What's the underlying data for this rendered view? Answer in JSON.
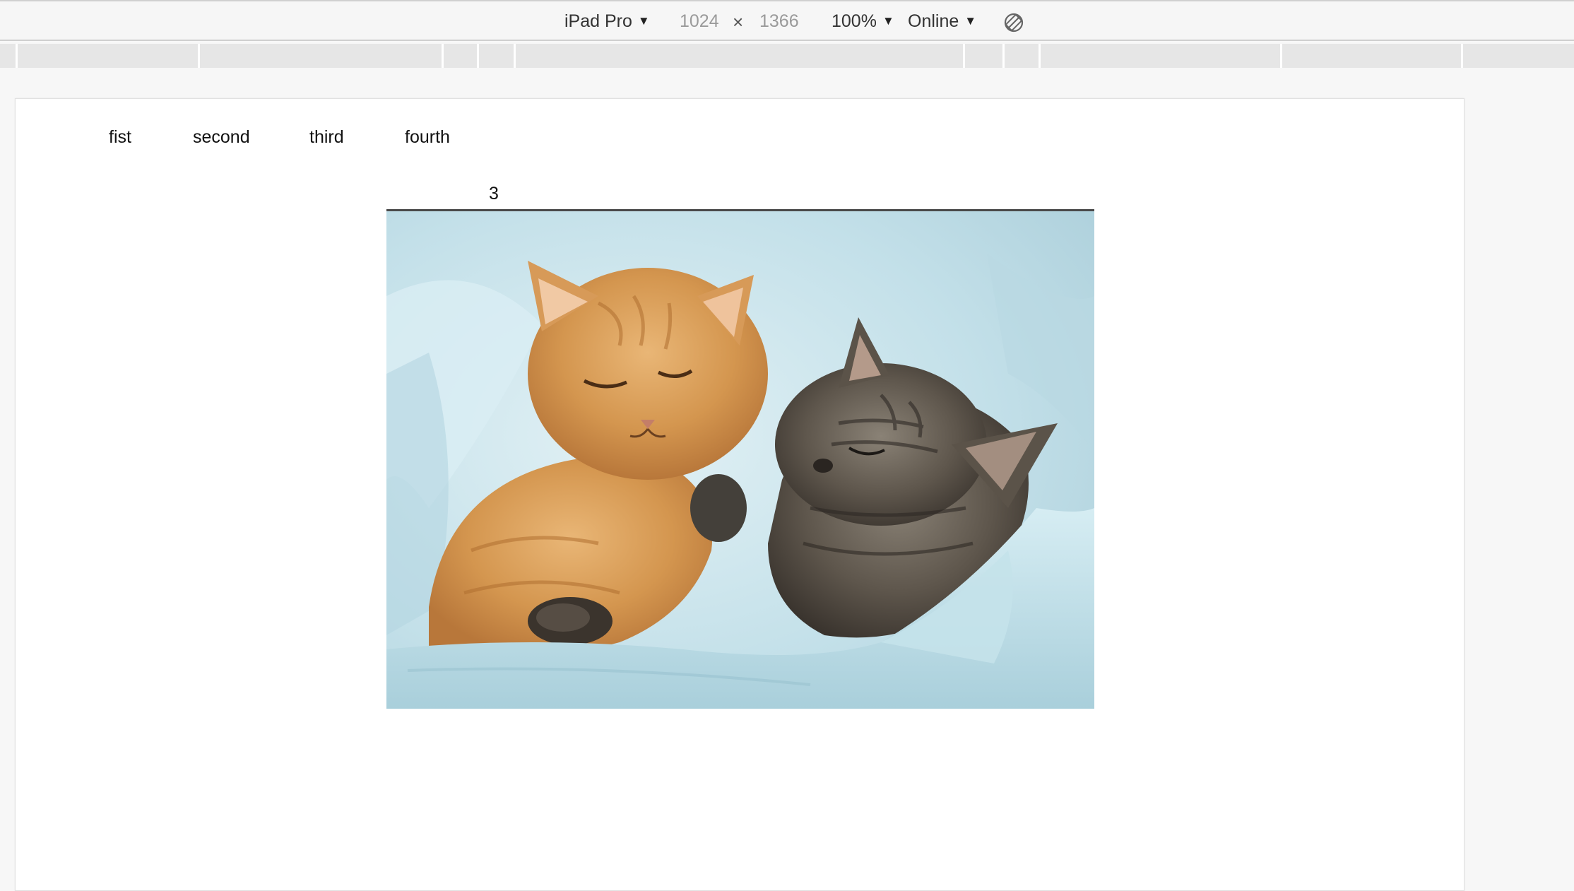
{
  "toolbar": {
    "device": "iPad Pro",
    "width": "1024",
    "times": "×",
    "height": "1366",
    "zoom": "100%",
    "network": "Online",
    "rotate_icon": "rotate-device-icon",
    "caret_icon": "▼"
  },
  "nav": {
    "links": [
      "fist",
      "second",
      "third",
      "fourth"
    ]
  },
  "carousel": {
    "current_index": "3",
    "image": "two sleeping kittens on a light blue blanket"
  },
  "colors": {
    "toolbar_bg": "#f6f6f6",
    "ruler_bg": "#e6e6e6",
    "page_bg": "#ffffff",
    "blanket": "#c9e4ec",
    "orange_kitten": "#d49a55",
    "tabby_kitten": "#5a534b"
  }
}
